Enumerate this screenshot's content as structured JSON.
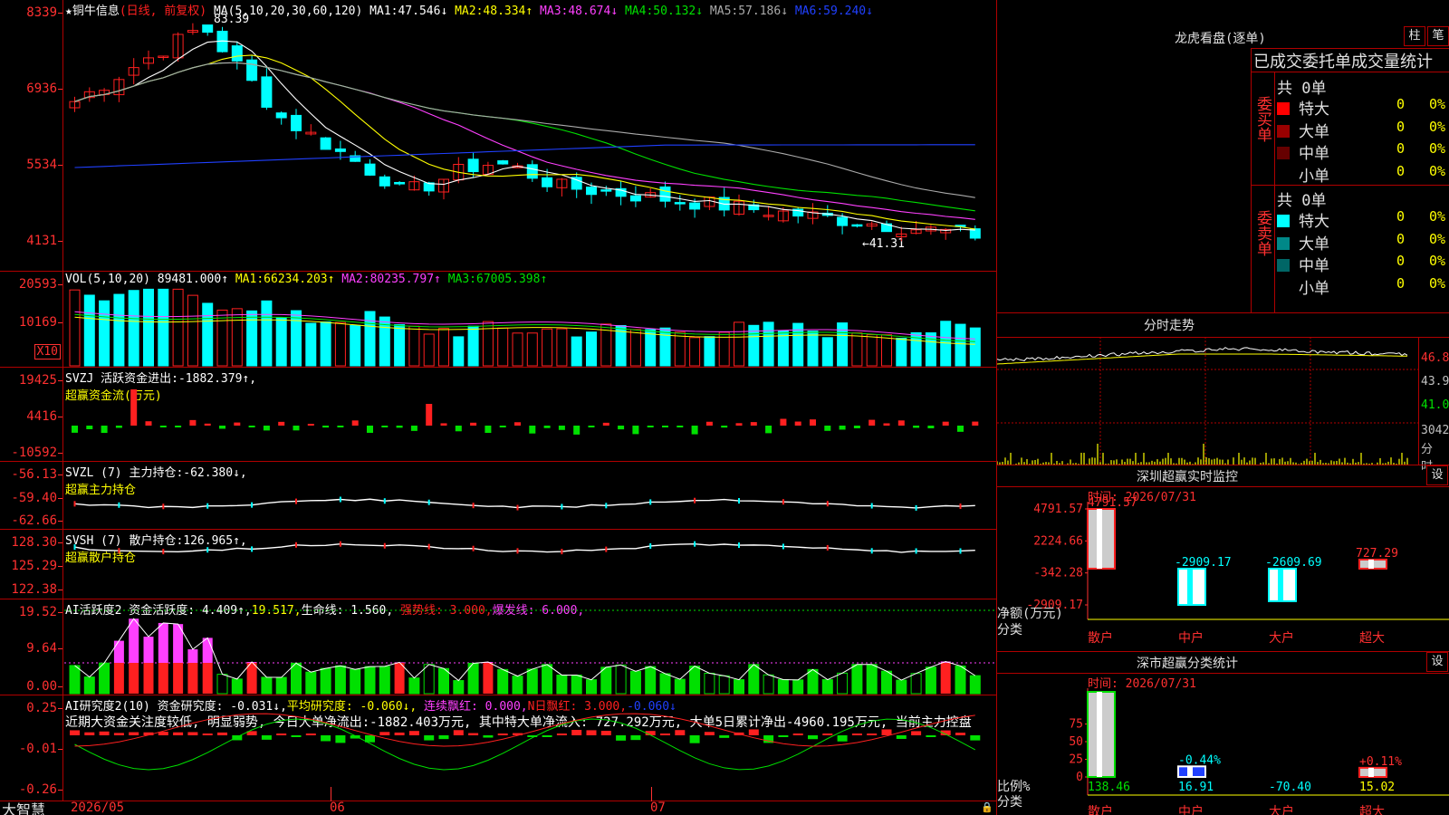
{
  "app": {
    "brand": "大智慧",
    "stock": "★铜牛信息",
    "period": "(日线, 前复权)"
  },
  "colors": {
    "up": "#ff2020",
    "down": "#00ffff",
    "ma1": "#ffffff",
    "ma2": "#ffff00",
    "ma3": "#ff40ff",
    "ma4": "#00e000",
    "ma5": "#aaaaaa",
    "ma6": "#2040ff",
    "grid": "#b00000"
  },
  "price_panel": {
    "ma_label": "MA(5,10,20,30,60,120)",
    "ma": [
      {
        "label": "MA1:",
        "value": "47.546↓"
      },
      {
        "label": "MA2:",
        "value": "48.334↑"
      },
      {
        "label": "MA3:",
        "value": "48.674↓"
      },
      {
        "label": "MA4:",
        "value": "50.132↓"
      },
      {
        "label": "MA5:",
        "value": "57.186↓"
      },
      {
        "label": "MA6:",
        "value": "59.240↓"
      }
    ],
    "y_ticks": [
      "8339",
      "6936",
      "5534",
      "4131"
    ],
    "high_note": "83.39",
    "low_note": "←41.31"
  },
  "vol_panel": {
    "title": "VOL(5,10,20)",
    "value": "89481.000↑",
    "ma": [
      {
        "label": "MA1:",
        "value": "66234.203↑"
      },
      {
        "label": "MA2:",
        "value": "80235.797↑"
      },
      {
        "label": "MA3:",
        "value": "67005.398↑"
      }
    ],
    "y_ticks": [
      "20593",
      "10169"
    ],
    "unit": "X10"
  },
  "svzj_panel": {
    "title": "SVZJ  活跃资金进出:",
    "value": "-1882.379↑,",
    "subtitle": "超赢资金流(万元)",
    "y_ticks": [
      "19425",
      "4416",
      "-10592"
    ]
  },
  "svzl_panel": {
    "title": "SVZL (7) 主力持仓:",
    "value": "-62.380↓,",
    "subtitle": "超赢主力持仓",
    "y_ticks": [
      "-56.13",
      "-59.40",
      "-62.66"
    ]
  },
  "svsh_panel": {
    "title": "SVSH (7) 散户持仓:",
    "value": "126.965↑,",
    "subtitle": "超赢散户持仓",
    "y_ticks": [
      "128.30",
      "125.29",
      "122.38"
    ]
  },
  "ai1_panel": {
    "title": "AI活跃度2 资金活跃度:",
    "v1": "4.409↑,",
    "v2": "19.517,",
    "v3": "生命线: 1.560,",
    "v4": "强势线: 3.000,",
    "v5": "爆发线: 6.000,",
    "y_ticks": [
      "19.52",
      "9.64",
      "0.00"
    ]
  },
  "ai2_panel": {
    "title": "AI研究度2(10) 资金研究度:",
    "v1": "-0.031↓,",
    "v2": "平均研究度: -0.060↓,",
    "v3": "连续飘红: 0.000,",
    "v4": "N日飘红: 3.000,",
    "v5": "-0.060↓",
    "comment": "近期大资金关注度较低, 明显弱势, 今日大单净流出:-1882.403万元, 其中特大单净流入: 727.292万元, 大单5日累计净出-4960.195万元, 当前主力控盘",
    "y_ticks": [
      "0.25",
      "-0.01",
      "-0.26"
    ]
  },
  "x_axis": {
    "labels": [
      "2026/05",
      "06",
      "07"
    ]
  },
  "lhb": {
    "title": "龙虎看盘(逐单)",
    "btn1": "柱",
    "btn2": "笔",
    "tabs": "已成交委托单成交量统计",
    "buy_side": "委买单",
    "sell_side": "委卖单",
    "buy_total": "共 0单",
    "sell_total": "共 0单",
    "buy_rows": [
      {
        "name": "特大",
        "count": "0",
        "pct": "0%",
        "color": "#ff0000"
      },
      {
        "name": "大单",
        "count": "0",
        "pct": "0%",
        "color": "#990000"
      },
      {
        "name": "中单",
        "count": "0",
        "pct": "0%",
        "color": "#660000"
      },
      {
        "name": "小单",
        "count": "0",
        "pct": "0%",
        "color": ""
      }
    ],
    "sell_rows": [
      {
        "name": "特大",
        "count": "0",
        "pct": "0%",
        "color": "#00ffff"
      },
      {
        "name": "大单",
        "count": "0",
        "pct": "0%",
        "color": "#008888"
      },
      {
        "name": "中单",
        "count": "0",
        "pct": "0%",
        "color": "#006666"
      },
      {
        "name": "小单",
        "count": "0",
        "pct": "0%",
        "color": ""
      }
    ]
  },
  "intraday": {
    "title": "分时走势",
    "y_labels": [
      "46.8",
      "43.9",
      "41.0",
      "3042",
      "分时"
    ]
  },
  "monitor": {
    "title": "深圳超赢实时监控",
    "settings": "设",
    "time": "时间: 2026/07/31",
    "y_ticks": [
      "4791.57",
      "2224.66",
      "-342.28",
      "-2909.17"
    ],
    "y_title": "净额(万元)",
    "x_title": "分类",
    "categories": [
      "散户",
      "中户",
      "大户",
      "超大"
    ],
    "values": [
      4791.57,
      -2909.17,
      -2609.69,
      727.29
    ],
    "value_labels": [
      "4791.57",
      "-2909.17",
      "-2609.69",
      "727.29"
    ]
  },
  "classify": {
    "title": "深市超赢分类统计",
    "settings": "设",
    "time": "时间: 2026/07/31",
    "y_ticks": [
      "75",
      "50",
      "25",
      "0"
    ],
    "y_title": "比例%",
    "x_title": "分类",
    "categories": [
      "散户",
      "中户",
      "大户",
      "超大"
    ],
    "values": [
      138.46,
      16.91,
      -70.4,
      15.02
    ],
    "bar_pct": [
      100,
      15,
      0,
      13
    ],
    "bar_labels": [
      "",
      "-0.44%",
      "",
      "+0.11%"
    ],
    "value_labels": [
      "138.46",
      "16.91",
      "-70.40",
      "15.02"
    ]
  }
}
